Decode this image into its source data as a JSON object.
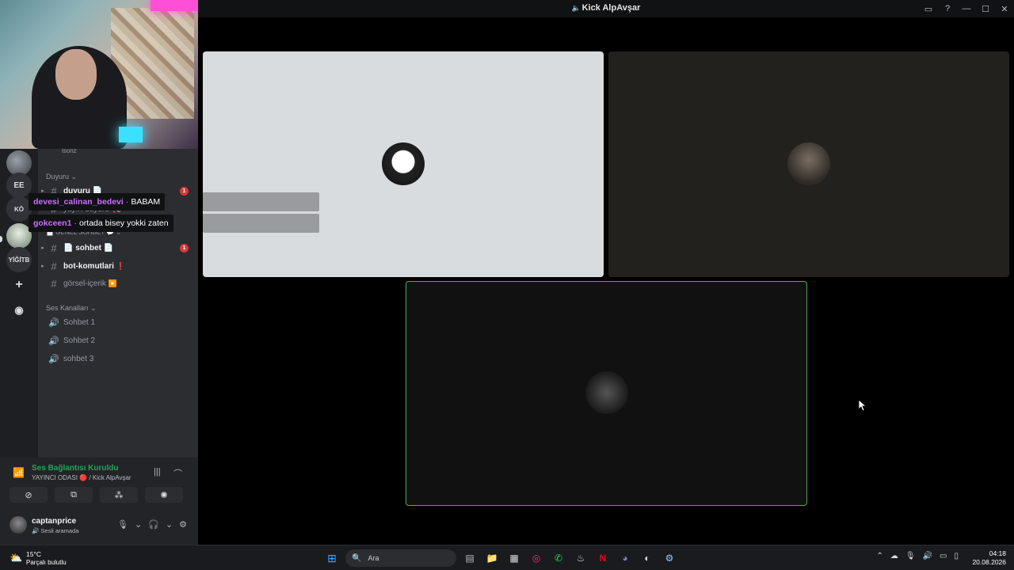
{
  "window": {
    "title": "Kick AlpAvşar",
    "controls": [
      "inbox-icon",
      "help-icon",
      "minimize-icon",
      "maximize-icon",
      "close-icon"
    ]
  },
  "rail": {
    "servers": [
      {
        "label": ""
      },
      {
        "label": "EE"
      },
      {
        "label": "KÖ"
      },
      {
        "label": ""
      },
      {
        "label": "YİĞİTB"
      }
    ],
    "add_icon": "+",
    "explore_icon": "compass-icon"
  },
  "channels": {
    "online_text": "isonz",
    "category_duyuru": "Duyuru ⌄",
    "duyuru": {
      "name": "duyuru 📄",
      "badge": "1"
    },
    "yayin_duyuru": {
      "name": "yayın-duyuru 📢"
    },
    "category_genel": "📄 GENEL SOHBET 💬 ⌄",
    "sohbet": {
      "name": "📄 sohbet 📄",
      "badge": "1"
    },
    "bot_komutlari": {
      "name": "bot-komutlari",
      "emoji": "❗"
    },
    "gorsel_icerik": {
      "name": "görsel-içerik",
      "emoji": "▶️"
    },
    "category_ses": "Ses Kanalları ⌄",
    "voice": [
      "Sohbet 1",
      "Sohbet 2",
      "sohbet 3"
    ]
  },
  "chat_overlay": [
    {
      "user": "devesi_calinan_bedevi",
      "message": "BABAM"
    },
    {
      "user": "gokceen1",
      "message": "ortada bisey yokki zaten"
    }
  ],
  "voice_panel": {
    "status": "Ses Bağlantısı Kuruldu",
    "channel": "YAYINCI ODASI 🔴 / Kick AlpAvşar"
  },
  "user_panel": {
    "name": "captanprice",
    "status": "🔊 Sesli aramada"
  },
  "taskbar": {
    "weather_temp": "15°C",
    "weather_desc": "Parçalı bulutlu",
    "search_placeholder": "Ara",
    "time": "04:18",
    "date": "20.08.2026"
  },
  "colors": {
    "speaking_border": "#4caf50",
    "unread_badge": "#da373c",
    "voice_connected": "#23a55a",
    "chat_username": "#c96eff"
  }
}
